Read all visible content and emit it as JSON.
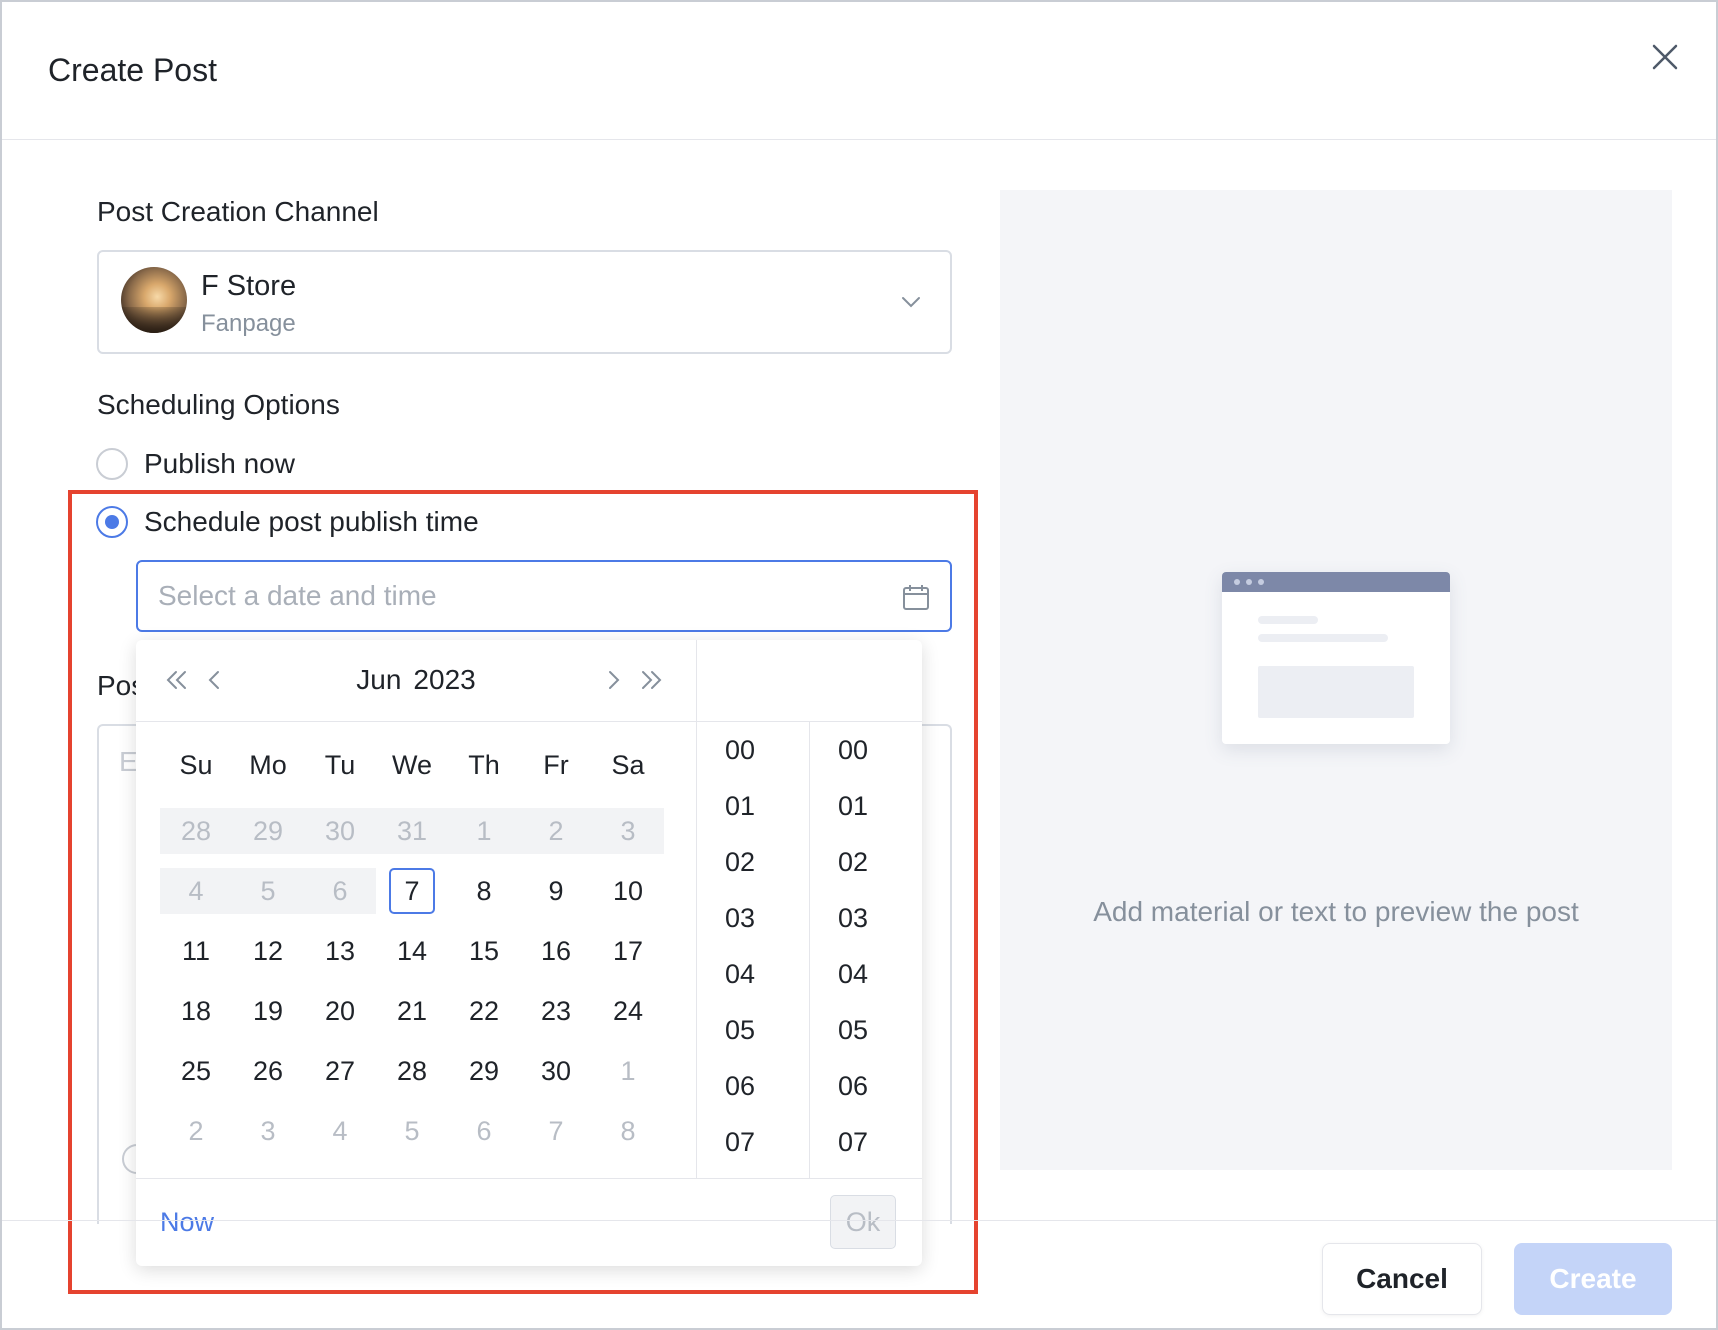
{
  "dialog": {
    "title": "Create Post",
    "close_icon": "close-icon"
  },
  "channel": {
    "label": "Post Creation Channel",
    "name": "F Store",
    "type": "Fanpage",
    "dropdown_icon": "chevron-down-icon"
  },
  "scheduling": {
    "label": "Scheduling Options",
    "options": [
      {
        "label": "Publish now",
        "checked": false
      },
      {
        "label": "Schedule post publish time",
        "checked": true
      }
    ],
    "date_input": {
      "value": "",
      "placeholder": "Select a date and time",
      "icon": "calendar-icon"
    }
  },
  "posts_peek": {
    "label": "Pos",
    "editor_hint": "E"
  },
  "picker": {
    "month": "Jun",
    "year": "2023",
    "weekdays": [
      "Su",
      "Mo",
      "Tu",
      "We",
      "Th",
      "Fr",
      "Sa"
    ],
    "weeks": [
      [
        {
          "d": "28",
          "s": "disabled"
        },
        {
          "d": "29",
          "s": "disabled"
        },
        {
          "d": "30",
          "s": "disabled"
        },
        {
          "d": "31",
          "s": "disabled"
        },
        {
          "d": "1",
          "s": "disabled"
        },
        {
          "d": "2",
          "s": "disabled"
        },
        {
          "d": "3",
          "s": "disabled"
        }
      ],
      [
        {
          "d": "4",
          "s": "disabled"
        },
        {
          "d": "5",
          "s": "disabled"
        },
        {
          "d": "6",
          "s": "disabled"
        },
        {
          "d": "7",
          "s": "today"
        },
        {
          "d": "8",
          "s": ""
        },
        {
          "d": "9",
          "s": ""
        },
        {
          "d": "10",
          "s": ""
        }
      ],
      [
        {
          "d": "11",
          "s": ""
        },
        {
          "d": "12",
          "s": ""
        },
        {
          "d": "13",
          "s": ""
        },
        {
          "d": "14",
          "s": ""
        },
        {
          "d": "15",
          "s": ""
        },
        {
          "d": "16",
          "s": ""
        },
        {
          "d": "17",
          "s": ""
        }
      ],
      [
        {
          "d": "18",
          "s": ""
        },
        {
          "d": "19",
          "s": ""
        },
        {
          "d": "20",
          "s": ""
        },
        {
          "d": "21",
          "s": ""
        },
        {
          "d": "22",
          "s": ""
        },
        {
          "d": "23",
          "s": ""
        },
        {
          "d": "24",
          "s": ""
        }
      ],
      [
        {
          "d": "25",
          "s": ""
        },
        {
          "d": "26",
          "s": ""
        },
        {
          "d": "27",
          "s": ""
        },
        {
          "d": "28",
          "s": ""
        },
        {
          "d": "29",
          "s": ""
        },
        {
          "d": "30",
          "s": ""
        },
        {
          "d": "1",
          "s": "muted"
        }
      ],
      [
        {
          "d": "2",
          "s": "muted"
        },
        {
          "d": "3",
          "s": "muted"
        },
        {
          "d": "4",
          "s": "muted"
        },
        {
          "d": "5",
          "s": "muted"
        },
        {
          "d": "6",
          "s": "muted"
        },
        {
          "d": "7",
          "s": "muted"
        },
        {
          "d": "8",
          "s": "muted"
        }
      ]
    ],
    "hours": [
      "00",
      "01",
      "02",
      "03",
      "04",
      "05",
      "06",
      "07"
    ],
    "minutes": [
      "00",
      "01",
      "02",
      "03",
      "04",
      "05",
      "06",
      "07"
    ],
    "now_label": "Now",
    "ok_label": "Ok"
  },
  "preview": {
    "text": "Add material or text to preview the post"
  },
  "footer": {
    "cancel_label": "Cancel",
    "create_label": "Create"
  },
  "colors": {
    "accent": "#4c7ae6",
    "highlight": "#e5432f",
    "create_disabled": "#c4d4f8"
  }
}
